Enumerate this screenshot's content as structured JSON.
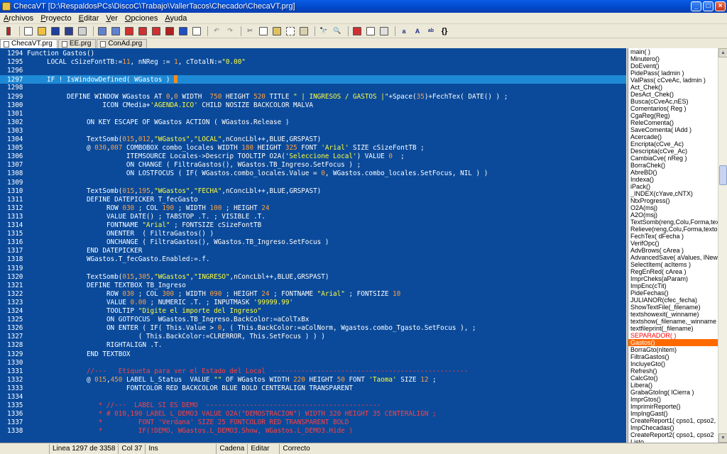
{
  "window": {
    "title": "ChecaVT [D:\\RespaldosPCs\\DiscoC\\Trabajo\\VallerTacos\\Checador\\ChecaVT.prg]"
  },
  "menu": [
    "Archivos",
    "Proyecto",
    "Editar",
    "Ver",
    "Opciones",
    "Ayuda"
  ],
  "tabs": [
    {
      "label": "ChecaVT.prg",
      "active": true
    },
    {
      "label": "EE.prg",
      "active": false
    },
    {
      "label": "ConAd.prg",
      "active": false
    }
  ],
  "code_lines": [
    {
      "n": "1294",
      "t": "Function Gastos()"
    },
    {
      "n": "1295",
      "t": "     LOCAL cSizeFontTB:=11, nNReg := 1, cTotalN:=\"0.00\""
    },
    {
      "n": "1296",
      "t": ""
    },
    {
      "n": "1297",
      "t": "     IF ! IsWindowDefined( WGastos ) ",
      "current": true
    },
    {
      "n": "1298",
      "t": ""
    },
    {
      "n": "1299",
      "t": "          DEFINE WINDOW WGastos AT 0,0 WIDTH  750 HEIGHT 520 TITLE \" | INGRESOS / GASTOS |\"+Space(35)+FechTex( DATE() ) ;"
    },
    {
      "n": "1300",
      "t": "                   ICON CMedia+'AGENDA.ICO' CHILD NOSIZE BACKCOLOR MALVA"
    },
    {
      "n": "1301",
      "t": ""
    },
    {
      "n": "1302",
      "t": "               ON KEY ESCAPE OF WGastos ACTION ( WGastos.Release )"
    },
    {
      "n": "1303",
      "t": ""
    },
    {
      "n": "1304",
      "t": "               TextSomb(015,012,\"WGastos\",\"LOCAL\",nConcLbl++,BLUE,GRSPAST)"
    },
    {
      "n": "1305",
      "t": "               @ 030,007 COMBOBOX combo_locales WIDTH 180 HEIGHT 325 FONT 'Arial' SIZE cSizeFontTB ;"
    },
    {
      "n": "1306",
      "t": "                         ITEMSOURCE Locales->Descrip TOOLTIP O2A('Seleccione Local') VALUE 0  ;"
    },
    {
      "n": "1307",
      "t": "                         ON CHANGE ( FiltraGastos(), WGastos.TB_Ingreso.SetFocus ) ;"
    },
    {
      "n": "1308",
      "t": "                         ON LOSTFOCUS ( IF( WGastos.combo_locales.Value = 0, WGastos.combo_locales.SetFocus, NIL ) )"
    },
    {
      "n": "1309",
      "t": ""
    },
    {
      "n": "1310",
      "t": "               TextSomb(015,195,\"WGastos\",\"FECHA\",nConcLbl++,BLUE,GRSPAST)"
    },
    {
      "n": "1311",
      "t": "               DEFINE DATEPICKER T_fecGasto"
    },
    {
      "n": "1312",
      "t": "                    ROW 030 ; COL 190 ; WIDTH 100 ; HEIGHT 24"
    },
    {
      "n": "1313",
      "t": "                    VALUE DATE() ; TABSTOP .T. ; VISIBLE .T."
    },
    {
      "n": "1314",
      "t": "                    FONTNAME \"Arial\" ; FONTSIZE cSizeFontTB"
    },
    {
      "n": "1315",
      "t": "                    ONENTER  ( FiltraGastos() )"
    },
    {
      "n": "1316",
      "t": "                    ONCHANGE ( FiltraGastos(), WGastos.TB_Ingreso.SetFocus )"
    },
    {
      "n": "1317",
      "t": "               END DATEPICKER"
    },
    {
      "n": "1318",
      "t": "               WGastos.T_fecGasto.Enabled:=.f."
    },
    {
      "n": "1319",
      "t": ""
    },
    {
      "n": "1320",
      "t": "               TextSomb(015,305,\"WGastos\",\"INGRESO\",nConcLbl++,BLUE,GRSPAST)"
    },
    {
      "n": "1321",
      "t": "               DEFINE TEXTBOX TB_Ingreso"
    },
    {
      "n": "1322",
      "t": "                    ROW 030 ; COL 300 ; WIDTH 090 ; HEIGHT 24 ; FONTNAME \"Arial\" ; FONTSIZE 10"
    },
    {
      "n": "1323",
      "t": "                    VALUE 0.00 ; NUMERIC .T. ; INPUTMASK '99999.99'"
    },
    {
      "n": "1324",
      "t": "                    TOOLTIP \"Digite el importe del Ingreso\""
    },
    {
      "n": "1325",
      "t": "                    ON GOTFOCUS  WGastos.TB_Ingreso.BackColor:=aColTxBx"
    },
    {
      "n": "1326",
      "t": "                    ON ENTER ( IF( This.Value > 0, ( This.BackColor:=aColNorm, Wgastos.combo_Tgasto.SetFocus ), ;"
    },
    {
      "n": "1327",
      "t": "                            ( This.BackColor:=CLRERROR, This.SetFocus ) ) )"
    },
    {
      "n": "1328",
      "t": "                    RIGHTALIGN .T."
    },
    {
      "n": "1329",
      "t": "               END TEXTBOX"
    },
    {
      "n": "1330",
      "t": ""
    },
    {
      "n": "1331",
      "t": "               //---   Etiqueta para ver el Estado del Local  -------------------------------------------------",
      "comment": true
    },
    {
      "n": "1332",
      "t": "               @ 015,450 LABEL L_Status  VALUE \"\" OF WGastos WIDTH 220 HEIGHT 50 FONT 'Taoma' SIZE 12 ;"
    },
    {
      "n": "1333",
      "t": "                         FONTCOLOR RED BACKCOLOR BLUE BOLD CENTERALIGN TRANSPARENT"
    },
    {
      "n": "1334",
      "t": ""
    },
    {
      "n": "1335",
      "t": "                  * //---  LABEL SI ES DEMO  --------------------------------------------",
      "comment": true
    },
    {
      "n": "1336",
      "t": "                  * # 010,190 LABEL L_DEMO3 VALUE O2A(\"DEMOSTRACION\") WIDTH 320 HEIGHT 35 CENTERALIGN ;",
      "comment": true
    },
    {
      "n": "1337",
      "t": "                  *         FONT 'Verdana' SIZE 25 FONTCOLOR RED TRANSPARENT BOLD",
      "comment": true
    },
    {
      "n": "1338",
      "t": "                  *         IF(!DEMO, WGastos.L_DEMO3.Show, WGastos.L_DEMO3.Hide )",
      "comment": true
    }
  ],
  "functions": [
    {
      "label": "main( )"
    },
    {
      "label": "Minutero()"
    },
    {
      "label": "DoEvent()"
    },
    {
      "label": "PidePass( ladmin )"
    },
    {
      "label": "ValPass( cCveAc, ladmin )"
    },
    {
      "label": "Act_Chek()"
    },
    {
      "label": "DesAct_Chek()"
    },
    {
      "label": "Busca(cCveAc,nES)"
    },
    {
      "label": "Comentarios( Reg )"
    },
    {
      "label": "CgaReg(Reg)"
    },
    {
      "label": "ReleComenta()"
    },
    {
      "label": "SaveComenta( lAdd )"
    },
    {
      "label": "Acercade()"
    },
    {
      "label": "Encripta(cCve_Ac)"
    },
    {
      "label": "Descripta(cCve_Ac)"
    },
    {
      "label": "CambiaCve( nReg )"
    },
    {
      "label": "BorraChek()"
    },
    {
      "label": "AbreBD()"
    },
    {
      "label": "Indexa()"
    },
    {
      "label": "iPack()"
    },
    {
      "label": "_INDEX(cYave,cNTX)"
    },
    {
      "label": "NtxProgress()"
    },
    {
      "label": "O2A(msj)"
    },
    {
      "label": "A2O(msj)"
    },
    {
      "label": "TextSomb(reng,Colu,Forma,tex"
    },
    {
      "label": "Relieve(reng,Colu,Forma,texto"
    },
    {
      "label": "FechTex( dFecha )"
    },
    {
      "label": "VerifOpc()"
    },
    {
      "label": "AdvBrows( cArea )"
    },
    {
      "label": "AdvancedSave( aValues, lNew"
    },
    {
      "label": "SelectItem( acItems )"
    },
    {
      "label": "RegEnRed( cArea )"
    },
    {
      "label": "ImprCheks(aParam)"
    },
    {
      "label": "ImpEnc(cTit)"
    },
    {
      "label": "PideFechas()"
    },
    {
      "label": "JULIANOR(cfec_fecha)"
    },
    {
      "label": "ShowTextFile(_filename)"
    },
    {
      "label": "textshowexit(_winname)"
    },
    {
      "label": "textshow(_filename,_winname"
    },
    {
      "label": "textfileprint(_filename)"
    },
    {
      "label": "SEPARADOR( )",
      "separator": true
    },
    {
      "label": "Gastos()",
      "selected": true
    },
    {
      "label": "BorraGto(nItem)"
    },
    {
      "label": "FiltraGastos()"
    },
    {
      "label": "IncluyeGto()"
    },
    {
      "label": "Refresh()"
    },
    {
      "label": "CalcGto()"
    },
    {
      "label": "Libera()"
    },
    {
      "label": "GrabaGtoIng( lCierra )"
    },
    {
      "label": "ImprGtos()"
    },
    {
      "label": "ImprimirReporte()"
    },
    {
      "label": "ImpIngGast()"
    },
    {
      "label": "CreateReport1( cpso1, cpso2,"
    },
    {
      "label": "ImpChecadas()"
    },
    {
      "label": "CreateReport2( cpso1, cpso2"
    },
    {
      "label": "Listo"
    }
  ],
  "status": {
    "position": "Linea 1297 de 3358",
    "column": "Col 37",
    "mode": "Ins",
    "chain": "Cadena",
    "edit": "Editar",
    "state": "Correcto"
  }
}
